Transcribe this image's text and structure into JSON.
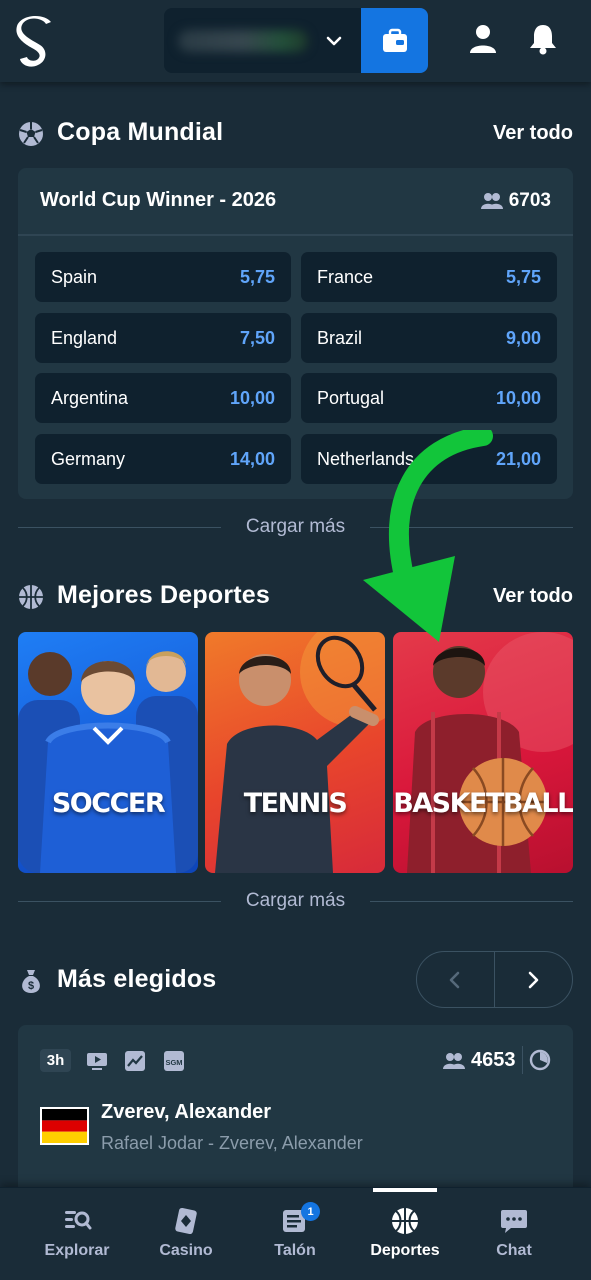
{
  "app": {
    "logo_letter": "S"
  },
  "header": {
    "balance_hidden": true
  },
  "world_cup": {
    "section_title": "Copa Mundial",
    "view_all": "Ver todo",
    "market_title": "World Cup Winner - 2026",
    "participants": "6703",
    "odds": [
      {
        "team": "Spain",
        "price": "5,75"
      },
      {
        "team": "France",
        "price": "5,75"
      },
      {
        "team": "England",
        "price": "7,50"
      },
      {
        "team": "Brazil",
        "price": "9,00"
      },
      {
        "team": "Argentina",
        "price": "10,00"
      },
      {
        "team": "Portugal",
        "price": "10,00"
      },
      {
        "team": "Germany",
        "price": "14,00"
      },
      {
        "team": "Netherlands",
        "price": "21,00"
      }
    ],
    "load_more": "Cargar más"
  },
  "top_sports": {
    "section_title": "Mejores Deportes",
    "view_all": "Ver todo",
    "tiles": [
      {
        "label": "SOCCER",
        "color": "#1a66e0"
      },
      {
        "label": "TENNIS",
        "color": "#e8532b"
      },
      {
        "label": "BASKETBALL",
        "color": "#d9173b"
      }
    ],
    "load_more": "Cargar más"
  },
  "most_picked": {
    "section_title": "Más elegidos",
    "match": {
      "time_badge": "3h",
      "participants": "4653",
      "player": "Zverev, Alexander",
      "event": "Rafael Jodar - Zverev, Alexander",
      "flag": "germany-flag"
    }
  },
  "bottom_nav": {
    "items": [
      {
        "label": "Explorar"
      },
      {
        "label": "Casino"
      },
      {
        "label": "Talón",
        "badge": "1"
      },
      {
        "label": "Deportes",
        "active": true
      },
      {
        "label": "Chat"
      }
    ]
  },
  "colors": {
    "accent_blue": "#1475e1",
    "odd_value": "#60a5fa",
    "annotation_arrow": "#12c53a"
  }
}
